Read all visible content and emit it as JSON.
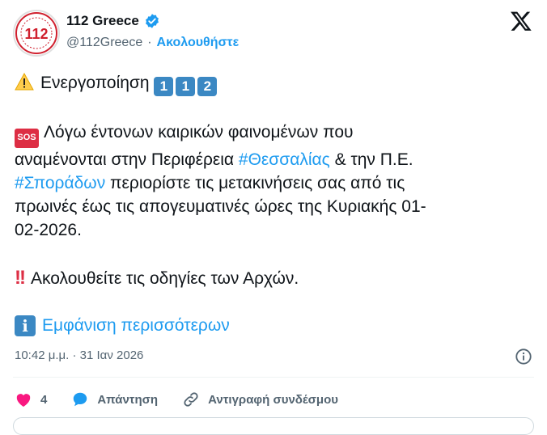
{
  "account": {
    "name": "112 Greece",
    "handle": "@112Greece",
    "separator": "·",
    "follow_label": "Ακολουθήστε",
    "avatar_text": "112"
  },
  "tweet": {
    "line1_text": "Ενεργοποίηση",
    "keycaps": [
      "1",
      "1",
      "2"
    ],
    "sos_label": "SOS",
    "para1_a": "Λόγω έντονων καιρικών φαινομένων που",
    "para1_b": "αναμένονται στην Περιφέρεια ",
    "tag1": "#Θεσσαλίας",
    "para1_c": " & την Π.Ε.",
    "tag2": "#Σποράδων",
    "para1_d": " περιορίστε τις μετακινήσεις σας από τις",
    "para1_e": "πρωινές έως τις απογευματινές ώρες της Κυριακής 01-",
    "para1_f": "02-2026.",
    "para2": "Ακολουθείτε τις οδηγίες των Αρχών.",
    "show_more": "Εμφάνιση περισσότερων",
    "info_glyph": "i",
    "timestamp": "10:42 μ.μ. · 31 Ιαν 2026"
  },
  "actions": {
    "like_count": "4",
    "reply_label": "Απάντηση",
    "copy_link_label": "Αντιγραφή συνδέσμου"
  },
  "colors": {
    "accent": "#1d9bf0",
    "heart": "#f91880",
    "keycap": "#3b88c3",
    "sos": "#dd2e44",
    "muted": "#536471"
  },
  "icons": [
    "verified-badge-icon",
    "x-logo-icon",
    "warning-icon",
    "info-icon",
    "heart-icon",
    "reply-bubble-icon",
    "link-icon"
  ]
}
